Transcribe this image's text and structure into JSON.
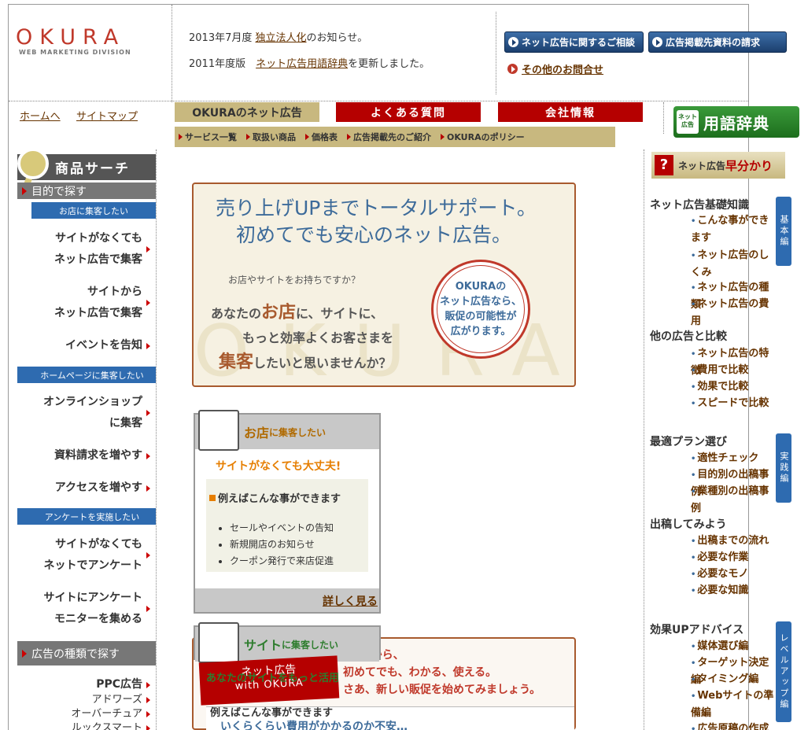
{
  "logo": {
    "name": "OKURA",
    "sub": "WEB MARKETING DIVISION"
  },
  "news": [
    {
      "prefix": "2013年7月度 ",
      "link": "独立法人化",
      "suffix": "のお知らせ。"
    },
    {
      "prefix": "2011年度版　",
      "link": "ネット広告用語辞典",
      "suffix": "を更新しました。"
    }
  ],
  "header_buttons": {
    "consult": "ネット広告に関するご相談",
    "materials": "広告掲載先資料の請求",
    "other": "その他のお問合せ"
  },
  "top_links": {
    "home": "ホームへ",
    "sitemap": "サイトマップ"
  },
  "tabs": [
    "OKURAのネット広告",
    "よくある質問",
    "会社情報"
  ],
  "subnav": [
    "サービス一覧",
    "取扱い商品",
    "価格表",
    "広告掲載先のご紹介",
    "OKURAのポリシー"
  ],
  "dictionary": {
    "small": "ネット広告",
    "big": "用語辞典"
  },
  "left": {
    "search_title": "商品サーチ",
    "by_purpose": "目的で探す",
    "sub_shop": "お店に集客したい",
    "shop_items": [
      "サイトがなくても\nネット広告で集客",
      "サイトから\nネット広告で集客",
      "イベントを告知"
    ],
    "sub_hp": "ホームページに集客したい",
    "hp_items": [
      "オンラインショップ\nに集客",
      "資料請求を増やす",
      "アクセスを増やす"
    ],
    "sub_survey": "アンケートを実施したい",
    "survey_items": [
      "サイトがなくても\nネットでアンケート",
      "サイトにアンケート\nモニターを集める"
    ],
    "by_type": "広告の種類で探す",
    "type_items": [
      "PPC広告",
      "アドワーズ",
      "オーバーチュア",
      "ルックスマート"
    ]
  },
  "hero": {
    "title1": "売り上げUPまでトータルサポート。",
    "title2": "初めてでも安心のネット広告。",
    "question": "お店やサイトをお持ちですか？",
    "line1a": "あなたの",
    "line1b": "お店",
    "line1c": "に、サイトに、",
    "line2": "もっと効率よくお客さまを",
    "line3a": "集客",
    "line3b": "したいと思いませんか？",
    "seal": "OKURAの\nネット広告なら、\n販促の可能性が\n広がります。",
    "watermark": "OKURA"
  },
  "card_shop": {
    "title": "お店",
    "title_small": "に集客したい",
    "tagline": "サイトがなくても大丈夫!",
    "example_head": "例えばこんな事ができます",
    "examples": [
      "セールやイベントの告知",
      "新規開店のお知らせ",
      "クーポン発行で来店促進"
    ],
    "more": "詳しく見る"
  },
  "card_site": {
    "title": "サイト",
    "title_small": "に集客したい",
    "text1": "RAだから、",
    "text2": "初めてでも、わかる、使える。",
    "text3": "さあ、新しい販促を始めてみましょう。",
    "badge1": "ネット広告",
    "badge2": "with OKURA",
    "overlay": "あなたのサイトをもっと活用",
    "example_head": "例えばこんな事ができます",
    "question": "いくらくらい費用がかかるのか不安…"
  },
  "right": {
    "head_small": "ネット広告",
    "head_big": "早分かり",
    "sections": [
      {
        "title": "ネット広告基礎知識",
        "items": [
          "こんな事ができます",
          "ネット広告のしくみ",
          "ネット広告の種類",
          "ネット広告の費用"
        ]
      },
      {
        "title": "他の広告と比較",
        "items": [
          "ネット広告の特徴",
          "費用で比較",
          "効果で比較",
          "スピードで比較"
        ]
      },
      {
        "title": "最適プラン選び",
        "items": [
          "適性チェック",
          "目的別の出稿事例",
          "業種別の出稿事例"
        ]
      },
      {
        "title": "出稿してみよう",
        "items": [
          "出稿までの流れ",
          "必要な作業",
          "必要なモノ",
          "必要な知識"
        ]
      },
      {
        "title": "効果UPアドバイス",
        "items": [
          "媒体選び編",
          "ターゲット決定編",
          "タイミング編",
          "Webサイトの準備編",
          "広告原稿の作成編"
        ]
      }
    ],
    "tabs": [
      "基本編",
      "実践編",
      "レベルアップ編"
    ]
  },
  "colors": {
    "brand_red": "#b50000",
    "brand_blue": "#2e6bb0",
    "gold": "#c8b87f",
    "brown": "#663300"
  }
}
